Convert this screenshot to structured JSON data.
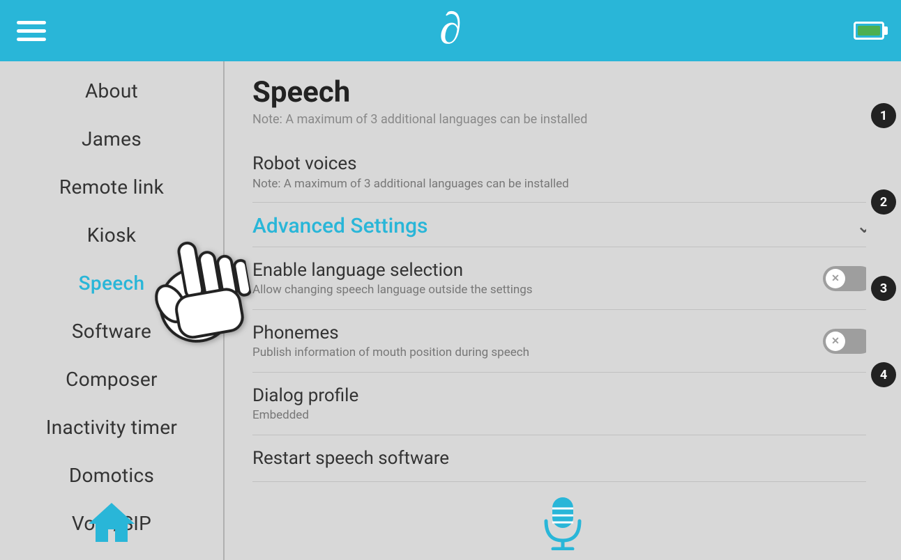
{
  "header": {
    "logo": "∂",
    "menu_label": "Menu",
    "battery_label": "Battery"
  },
  "sidebar": {
    "items": [
      {
        "id": "about",
        "label": "About",
        "active": false
      },
      {
        "id": "james",
        "label": "James",
        "active": false
      },
      {
        "id": "remote-link",
        "label": "Remote link",
        "active": false
      },
      {
        "id": "kiosk",
        "label": "Kiosk",
        "active": false
      },
      {
        "id": "speech",
        "label": "Speech",
        "active": true
      },
      {
        "id": "software",
        "label": "Software",
        "active": false
      },
      {
        "id": "composer",
        "label": "Composer",
        "active": false
      },
      {
        "id": "inactivity-timer",
        "label": "Inactivity timer",
        "active": false
      },
      {
        "id": "domotics",
        "label": "Domotics",
        "active": false
      },
      {
        "id": "voip-sip",
        "label": "VoIP/SIP",
        "active": false
      }
    ],
    "home_label": "Home"
  },
  "content": {
    "title": "Speech",
    "subtitle": "Note: A maximum of 3 additional languages can be installed",
    "robot_voices": {
      "title": "Robot voices",
      "desc": "Note: A maximum of 3 additional languages can be installed"
    },
    "advanced_settings": {
      "title": "Advanced Settings",
      "chevron": "∨"
    },
    "enable_language": {
      "title": "Enable language selection",
      "desc": "Allow changing speech language outside the settings",
      "toggle_state": "off"
    },
    "phonemes": {
      "title": "Phonemes",
      "desc": "Publish information of mouth position during speech",
      "toggle_state": "off"
    },
    "dialog_profile": {
      "title": "Dialog profile",
      "value": "Embedded"
    },
    "restart_speech": {
      "title": "Restart speech software"
    }
  },
  "scrollbar": {
    "markers": [
      "1",
      "2",
      "3",
      "4"
    ]
  },
  "footer": {
    "mic_label": "Microphone"
  }
}
